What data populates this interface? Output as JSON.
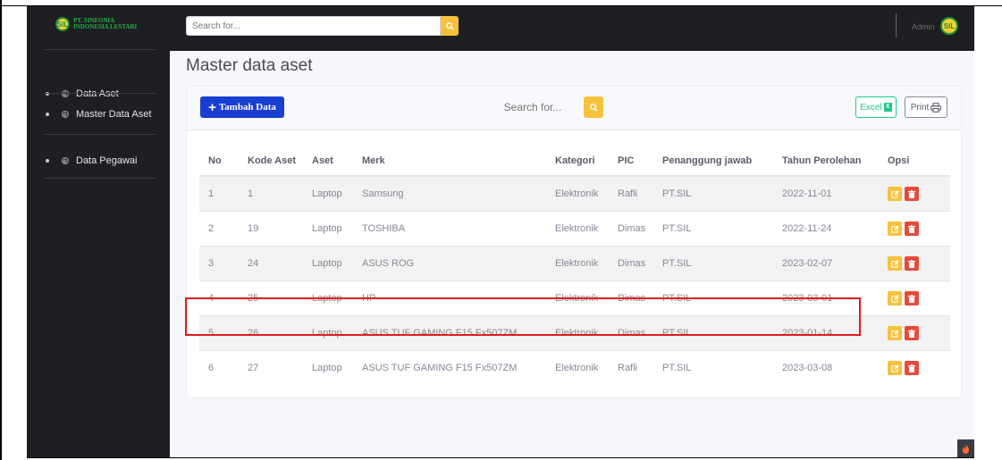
{
  "brand": {
    "logo_text_line1": "PT. SINFONIA",
    "logo_text_line2": "INDONESIA LESTARI",
    "logo_badge": "SIL"
  },
  "sidebar": {
    "items": [
      {
        "label": "Data Aset"
      },
      {
        "label": "Master Data Aset"
      },
      {
        "label": "Data Pegawai"
      }
    ]
  },
  "topbar": {
    "search_placeholder": "Search for...",
    "user_label": "Admin",
    "avatar_badge": "SIL"
  },
  "page": {
    "title": "Master data aset"
  },
  "toolbar": {
    "add_label": "Tambah Data",
    "search_placeholder": "Search for...",
    "excel_label": "Excel",
    "print_label": "Print"
  },
  "table": {
    "headers": [
      "No",
      "Kode Aset",
      "Aset",
      "Merk",
      "Kategori",
      "PIC",
      "Penanggung jawab",
      "Tahun Perolehan",
      "Opsi"
    ],
    "rows": [
      [
        "1",
        "1",
        "Laptop",
        "Samsung",
        "Elektronik",
        "Rafli",
        "PT.SIL",
        "2022-11-01"
      ],
      [
        "2",
        "19",
        "Laptop",
        "TOSHIBA",
        "Elektronik",
        "Dimas",
        "PT.SIL",
        "2022-11-24"
      ],
      [
        "3",
        "24",
        "Laptop",
        "ASUS ROG",
        "Elektronik",
        "Dimas",
        "PT.SIL",
        "2023-02-07"
      ],
      [
        "4",
        "25",
        "Laptop",
        "HP",
        "Elektronik",
        "Dimas",
        "PT.SIL",
        "2023-03-01"
      ],
      [
        "5",
        "26",
        "Laptop",
        "ASUS TUF GAMING F15 Fx507ZM",
        "Elektronik",
        "Dimas",
        "PT.SIL",
        "2023-01-14"
      ],
      [
        "6",
        "27",
        "Laptop",
        "ASUS TUF GAMING F15 Fx507ZM",
        "Elektronik",
        "Rafli",
        "PT.SIL",
        "2023-03-08"
      ]
    ]
  },
  "icons": {
    "search": "search-icon",
    "edit": "edit-icon",
    "delete": "trash-icon",
    "print": "printer-icon",
    "scroll": "scroll-top-icon"
  },
  "colors": {
    "primary": "#1a3ed1",
    "warning": "#f6c23e",
    "danger": "#e74a3b",
    "success": "#1cc88a",
    "sidebar": "#1d1f22",
    "highlight": "#e01c1c"
  }
}
